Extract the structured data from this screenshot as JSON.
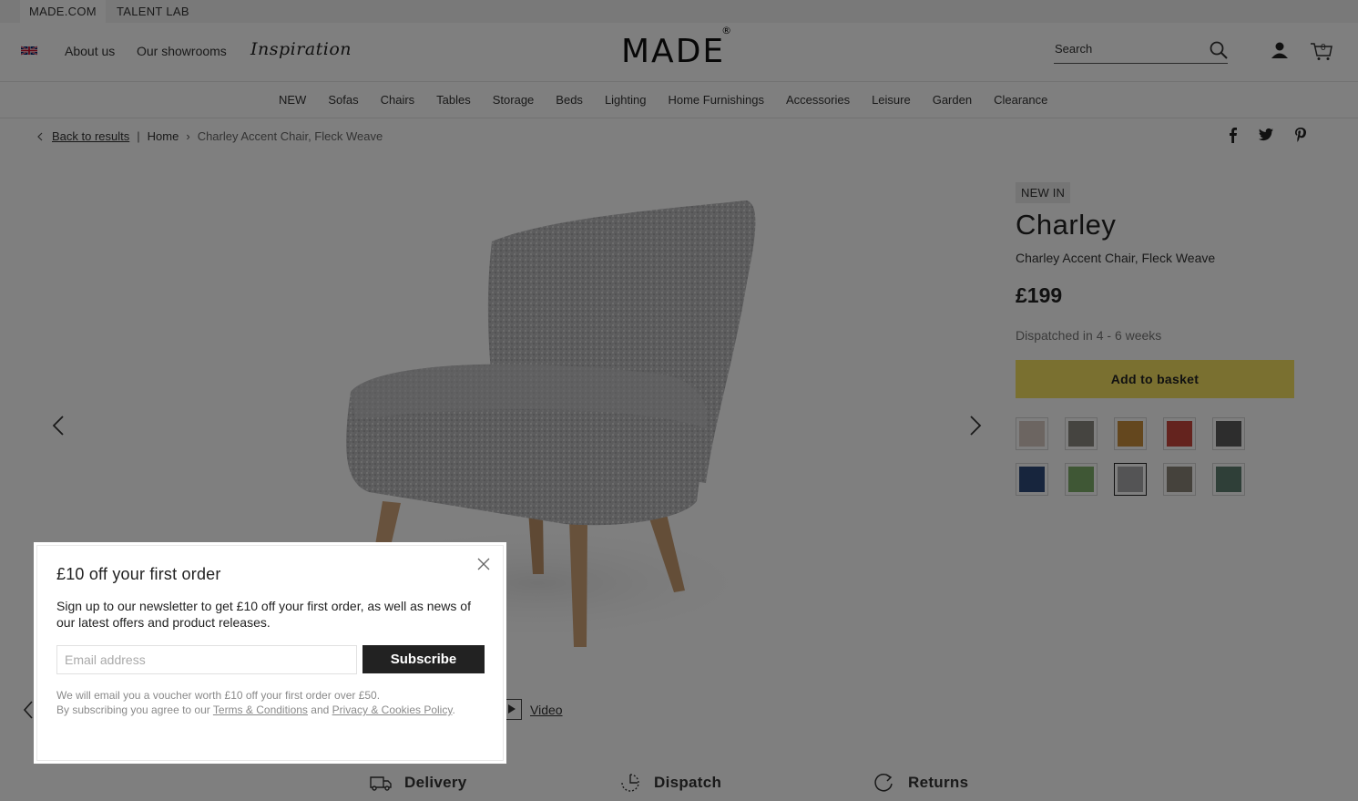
{
  "topbar": {
    "tabs": [
      "MADE.COM",
      "TALENT LAB"
    ]
  },
  "header": {
    "links": [
      "About us",
      "Our showrooms"
    ],
    "inspiration": "Inspiration",
    "logo": "MADE",
    "logo_mark": "®",
    "search_label": "Search",
    "basket_count": "0"
  },
  "nav": {
    "items": [
      "NEW",
      "Sofas",
      "Chairs",
      "Tables",
      "Storage",
      "Beds",
      "Lighting",
      "Home Furnishings",
      "Accessories",
      "Leisure",
      "Garden",
      "Clearance"
    ]
  },
  "breadcrumb": {
    "back": "Back to results",
    "divider": "|",
    "home": "Home",
    "current": "Charley Accent Chair, Fleck Weave"
  },
  "product": {
    "badge": "NEW IN",
    "name": "Charley",
    "subtitle": "Charley Accent Chair, Fleck Weave",
    "price": "£199",
    "dispatch": "Dispatched in 4 - 6 weeks",
    "add_to_basket": "Add to basket",
    "swatch_colors": [
      "#d8cbc2",
      "#8a8880",
      "#c98f3c",
      "#c8463d",
      "#5a5a5a",
      "#2e4a7a",
      "#7fae6a",
      "#a9a9ab",
      "#8a8478",
      "#5f7f70"
    ],
    "selected_swatch": 7
  },
  "gallery": {
    "video_label": "Video"
  },
  "features": [
    "Delivery",
    "Dispatch",
    "Returns"
  ],
  "modal": {
    "title": "£10 off your first order",
    "body": "Sign up to our newsletter to get £10 off your first order, as well as news of our latest offers and product releases.",
    "email_placeholder": "Email address",
    "subscribe": "Subscribe",
    "fine_line1": "We will email you a voucher worth £10 off your first order over £50.",
    "fine_line2_prefix": "By subscribing you agree to our ",
    "terms_link": "Terms & Conditions",
    "fine_and": " and ",
    "privacy_link": "Privacy & Cookies Policy",
    "fine_end": "."
  }
}
